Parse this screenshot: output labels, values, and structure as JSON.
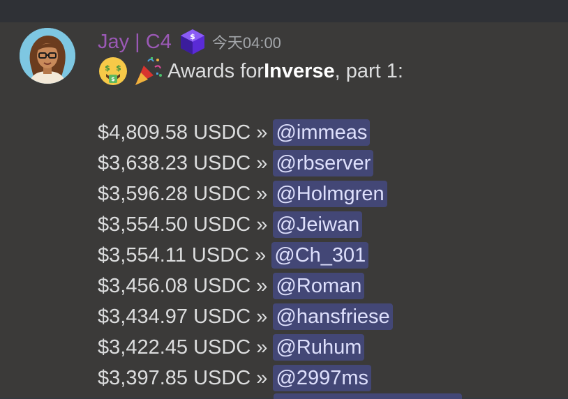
{
  "message": {
    "username": "Jay | C4",
    "badge_icon": "code4rena-badge-icon",
    "timestamp": "今天04:00",
    "intro": {
      "emoji_1": "money-mouth-face-icon",
      "emoji_2": "party-popper-icon",
      "text_before": "Awards for ",
      "bold": "Inverse",
      "text_after": ", part 1:"
    },
    "awards": [
      {
        "amount": "$4,809.58 USDC »",
        "mention": "@immeas"
      },
      {
        "amount": "$3,638.23 USDC »",
        "mention": "@rbserver"
      },
      {
        "amount": "$3,596.28 USDC »",
        "mention": "@Holmgren"
      },
      {
        "amount": "$3,554.50 USDC »",
        "mention": "@Jeiwan"
      },
      {
        "amount": "$3,554.11 USDC »",
        "mention": "@Ch_301"
      },
      {
        "amount": "$3,456.08 USDC »",
        "mention": "@Roman"
      },
      {
        "amount": "$3,434.97 USDC »",
        "mention": "@hansfriese"
      },
      {
        "amount": "$3,422.45 USDC »",
        "mention": "@Ruhum"
      },
      {
        "amount": "$3,397.85 USDC »",
        "mention": "@2997ms"
      }
    ]
  },
  "colors": {
    "background": "#36393f",
    "username": "#9b59b6",
    "mention_bg": "#434776",
    "mention_text": "#dee0fc"
  }
}
